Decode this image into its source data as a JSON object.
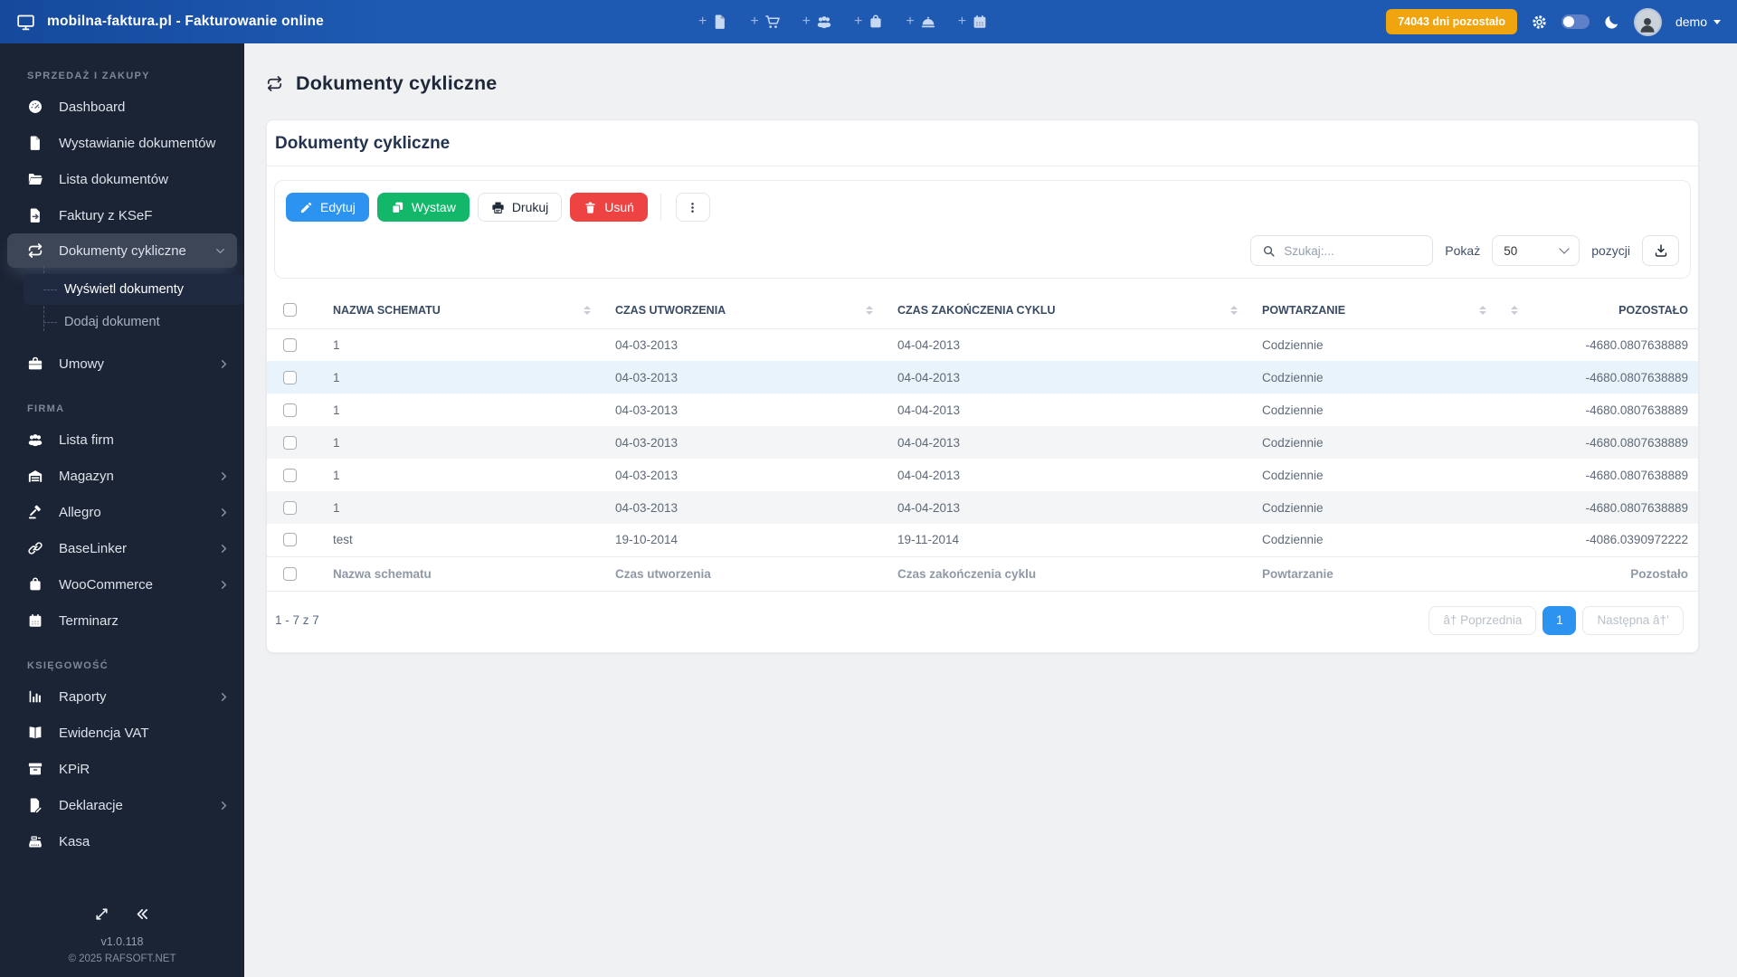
{
  "topbar": {
    "brand": "mobilna-faktura.pl - Fakturowanie online",
    "quick_add_icons": [
      "invoice-icon",
      "cart-icon",
      "contractors-icon",
      "product-icon",
      "service-icon",
      "event-icon"
    ],
    "trial_badge": "74043 dni pozostało",
    "user": "demo"
  },
  "sidebar": {
    "sections": [
      {
        "label": "SPRZEDAŻ I ZAKUPY",
        "items": [
          {
            "label": "Dashboard",
            "icon": "dashboard-icon"
          },
          {
            "label": "Wystawianie dokumentów",
            "icon": "document-icon"
          },
          {
            "label": "Lista dokumentów",
            "icon": "folder-icon"
          },
          {
            "label": "Faktury z KSeF",
            "icon": "file-import-icon"
          },
          {
            "label": "Dokumenty cykliczne",
            "icon": "repeat-icon",
            "expanded": true,
            "children": [
              {
                "label": "Wyświetl dokumenty",
                "active": true
              },
              {
                "label": "Dodaj dokument",
                "active": false
              }
            ]
          },
          {
            "label": "Umowy",
            "icon": "briefcase-icon",
            "has_submenu": true
          }
        ]
      },
      {
        "label": "FIRMA",
        "items": [
          {
            "label": "Lista firm",
            "icon": "companies-icon"
          },
          {
            "label": "Magazyn",
            "icon": "warehouse-icon",
            "has_submenu": true
          },
          {
            "label": "Allegro",
            "icon": "gavel-icon",
            "has_submenu": true
          },
          {
            "label": "BaseLinker",
            "icon": "link-icon",
            "has_submenu": true
          },
          {
            "label": "WooCommerce",
            "icon": "box-icon",
            "has_submenu": true
          },
          {
            "label": "Terminarz",
            "icon": "calendar-icon"
          }
        ]
      },
      {
        "label": "KSIĘGOWOŚĆ",
        "items": [
          {
            "label": "Raporty",
            "icon": "chart-icon",
            "has_submenu": true
          },
          {
            "label": "Ewidencja VAT",
            "icon": "book-icon"
          },
          {
            "label": "KPiR",
            "icon": "archive-icon"
          },
          {
            "label": "Deklaracje",
            "icon": "file-signature-icon",
            "has_submenu": true
          },
          {
            "label": "Kasa",
            "icon": "cash-register-icon"
          }
        ]
      }
    ],
    "footer": {
      "version": "v1.0.118",
      "copyright": "© 2025 RAFSOFT.NET"
    }
  },
  "page": {
    "title": "Dokumenty cykliczne"
  },
  "card": {
    "title": "Dokumenty cykliczne",
    "toolbar": {
      "edit": "Edytuj",
      "issue": "Wystaw",
      "print": "Drukuj",
      "delete": "Usuń"
    },
    "search_placeholder": "Szukaj:...",
    "show_label": "Pokaż",
    "page_size": "50",
    "positions_label": "pozycji"
  },
  "table": {
    "headers": [
      "NAZWA SCHEMATU",
      "CZAS UTWORZENIA",
      "CZAS ZAKOŃCZENIA CYKLU",
      "POWTARZANIE",
      "POZOSTAŁO"
    ],
    "rows": [
      {
        "name": "1",
        "created": "04-03-2013",
        "cycle_end": "04-04-2013",
        "repeat": "Codziennie",
        "remaining": "-4680.0807638889"
      },
      {
        "name": "1",
        "created": "04-03-2013",
        "cycle_end": "04-04-2013",
        "repeat": "Codziennie",
        "remaining": "-4680.0807638889"
      },
      {
        "name": "1",
        "created": "04-03-2013",
        "cycle_end": "04-04-2013",
        "repeat": "Codziennie",
        "remaining": "-4680.0807638889"
      },
      {
        "name": "1",
        "created": "04-03-2013",
        "cycle_end": "04-04-2013",
        "repeat": "Codziennie",
        "remaining": "-4680.0807638889"
      },
      {
        "name": "1",
        "created": "04-03-2013",
        "cycle_end": "04-04-2013",
        "repeat": "Codziennie",
        "remaining": "-4680.0807638889"
      },
      {
        "name": "1",
        "created": "04-03-2013",
        "cycle_end": "04-04-2013",
        "repeat": "Codziennie",
        "remaining": "-4680.0807638889"
      },
      {
        "name": "test",
        "created": "19-10-2014",
        "cycle_end": "19-11-2014",
        "repeat": "Codziennie",
        "remaining": "-4086.0390972222"
      }
    ],
    "footer_labels": [
      "Nazwa schematu",
      "Czas utworzenia",
      "Czas zakończenia cyklu",
      "Powtarzanie",
      "Pozostało"
    ]
  },
  "pagination": {
    "info": "1 - 7 z 7",
    "prev_label": "â† Poprzednia",
    "current_page": "1",
    "next_label": "Następna â†’"
  },
  "colors": {
    "topbar_blue": "#1e5ab2",
    "sidebar_bg": "#1b2435",
    "accent_blue": "#2d93f0",
    "green": "#12b76a",
    "red": "#ee4343",
    "orange_badge": "#f0a40e",
    "row_highlight": "#e9f3fc",
    "row_stripe": "#f4f5f6"
  }
}
